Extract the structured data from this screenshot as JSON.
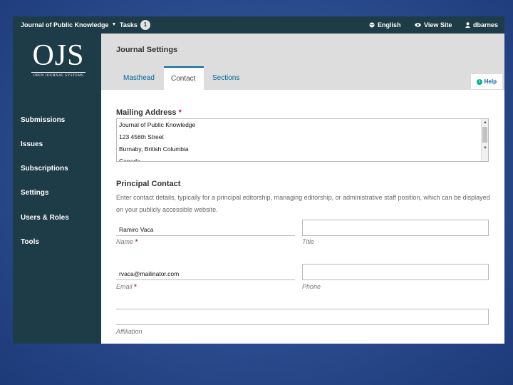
{
  "topbar": {
    "journal_name": "Journal of Public Knowledge",
    "tasks_label": "Tasks",
    "tasks_count": "1",
    "language": "English",
    "view_site": "View Site",
    "username": "dbarnes"
  },
  "logo": {
    "main": "OJS",
    "sub": "OPEN JOURNAL SYSTEMS"
  },
  "sidebar": {
    "items": [
      {
        "label": "Submissions"
      },
      {
        "label": "Issues"
      },
      {
        "label": "Subscriptions"
      },
      {
        "label": "Settings"
      },
      {
        "label": "Users & Roles"
      },
      {
        "label": "Tools"
      }
    ]
  },
  "header": {
    "title": "Journal Settings",
    "tabs": [
      {
        "label": "Masthead",
        "active": false
      },
      {
        "label": "Contact",
        "active": true
      },
      {
        "label": "Sections",
        "active": false
      }
    ],
    "help": "Help"
  },
  "mailing": {
    "title": "Mailing Address",
    "required_mark": "*",
    "lines": [
      "Journal of Public Knowledge",
      "123 456th Street",
      "Burnaby, British Columbia",
      "Canada"
    ]
  },
  "principal": {
    "title": "Principal Contact",
    "description": "Enter contact details, typically for a principal editorship, managing editorship, or administrative staff position, which can be displayed on your publicly accessible website.",
    "name": {
      "value": "Ramiro Vaca",
      "label": "Name",
      "required_mark": "*"
    },
    "title_field": {
      "value": "",
      "label": "Title"
    },
    "email": {
      "value": "rvaca@mailinator.com",
      "label": "Email",
      "required_mark": "*"
    },
    "phone": {
      "value": "",
      "label": "Phone"
    },
    "affiliation": {
      "value": "",
      "label": "Affiliation"
    }
  },
  "colors": {
    "sidebar": "#1e3b48",
    "accent": "#006798",
    "required": "#d00a6c",
    "help_icon": "#00b28d"
  },
  "icons": [
    "caret-down-icon",
    "globe-icon",
    "eye-icon",
    "user-icon",
    "help-icon"
  ]
}
